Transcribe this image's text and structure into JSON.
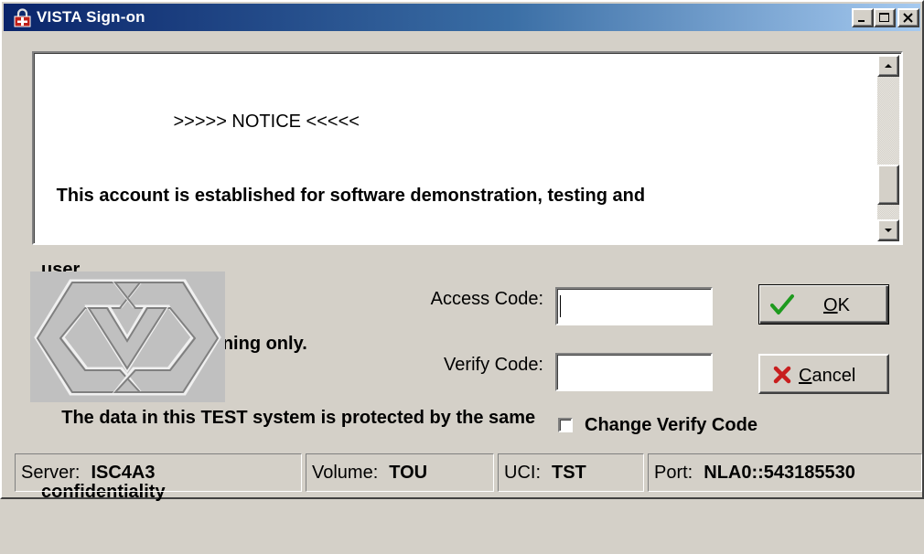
{
  "window": {
    "title": "VISTA Sign-on"
  },
  "notice": {
    "lines": [
      "                          >>>>> NOTICE <<<<<",
      "   This account is established for software demonstration, testing and",
      "user",
      "                              training only.",
      "    The data in this TEST system is protected by the same",
      "confidentiality"
    ]
  },
  "form": {
    "access_label": "Access Code:",
    "verify_label": "Verify Code:",
    "access_value": "",
    "verify_value": "",
    "change_verify_label": "Change Verify Code",
    "change_verify_checked": false
  },
  "buttons": {
    "ok": {
      "mnemonic": "O",
      "rest": "K"
    },
    "cancel": {
      "mnemonic": "C",
      "rest": "ancel"
    }
  },
  "status": {
    "server": {
      "key": "Server:",
      "value": "ISC4A3"
    },
    "volume": {
      "key": "Volume:",
      "value": "TOU"
    },
    "uci": {
      "key": "UCI:",
      "value": "TST"
    },
    "port": {
      "key": "Port:",
      "value": "NLA0::543185530"
    }
  },
  "icons": {
    "app": "vista-lock-icon",
    "ok": "checkmark-icon",
    "cancel": "x-mark-icon",
    "logo": "va-logo"
  },
  "colors": {
    "titlebar_start": "#0a246a",
    "titlebar_end": "#a6caf0",
    "ok_check": "#1e9a1e",
    "cancel_x": "#c81e1e",
    "window_face": "#d4d0c8"
  }
}
